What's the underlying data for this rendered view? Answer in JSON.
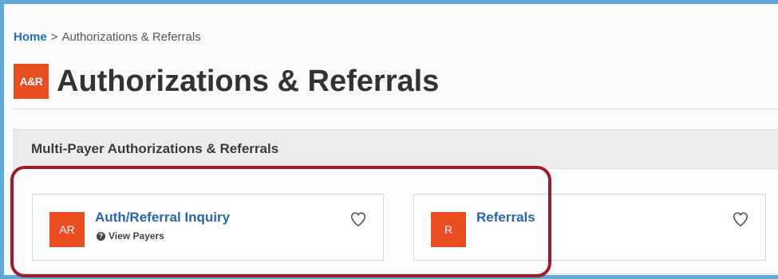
{
  "breadcrumb": {
    "home": "Home",
    "separator": ">",
    "current": "Authorizations & Referrals"
  },
  "header": {
    "app_icon_label": "A&R",
    "title": "Authorizations & Referrals"
  },
  "section": {
    "title": "Multi-Payer Authorizations & Referrals"
  },
  "cards": [
    {
      "icon_label": "AR",
      "title": "Auth/Referral Inquiry",
      "subtitle": "View Payers",
      "favorite_icon": "heart-outline-icon"
    },
    {
      "icon_label": "R",
      "title": "Referrals",
      "favorite_icon": "heart-outline-icon"
    }
  ],
  "colors": {
    "accent_orange": "#e84e1f",
    "link_blue": "#2a64b0",
    "highlight_red": "#9b1d2a",
    "frame_blue": "#5fa9d6"
  }
}
